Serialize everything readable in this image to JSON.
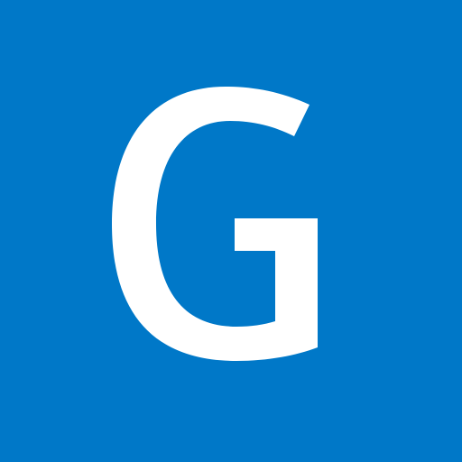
{
  "tile": {
    "letter": "G",
    "background_color": "#0078c8",
    "letter_color": "#ffffff"
  }
}
